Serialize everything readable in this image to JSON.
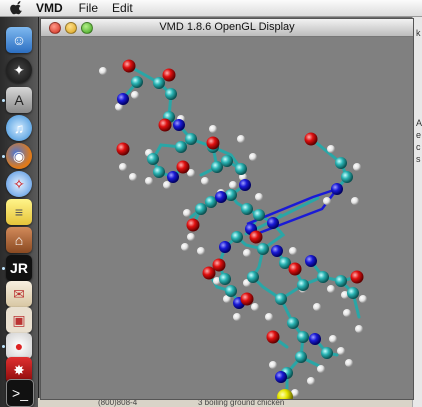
{
  "menubar": {
    "app_name": "VMD",
    "items": [
      "File",
      "Edit"
    ]
  },
  "window": {
    "title": "VMD 1.8.6 OpenGL Display"
  },
  "dock": {
    "icons": [
      "finder-icon",
      "quicksilver-icon",
      "typewriter-icon",
      "itunes-icon",
      "firefox-icon",
      "safari-icon",
      "stickies-icon",
      "home-icon",
      "jr-icon",
      "letter-icon",
      "terminal-icon",
      "molecule-icon",
      "red-app-icon",
      "terminal2-icon",
      "gimp-icon"
    ]
  },
  "bottom_strip": {
    "left_text": "(800)808-4",
    "right_text": "3 boiling ground chicken"
  },
  "colors": {
    "carbon": "#2aa6a6",
    "oxygen": "#e01010",
    "nitrogen": "#1a1ad6",
    "hydrogen": "#e8e8e8",
    "sulfur": "#e6e600",
    "background": "#808080"
  }
}
